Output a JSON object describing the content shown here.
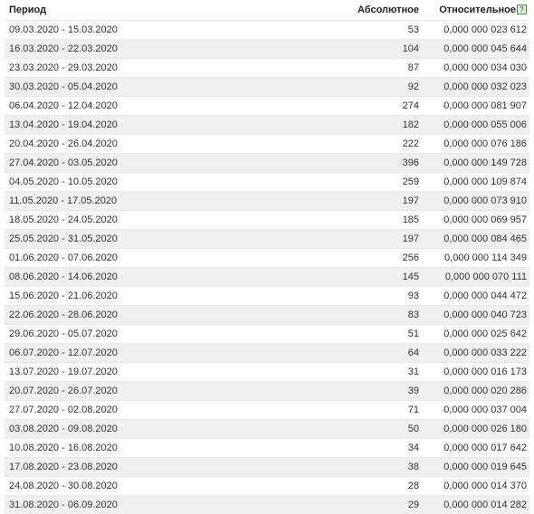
{
  "headers": {
    "period": "Период",
    "absolute": "Абсолютное",
    "relative": "Относительное",
    "help_symbol": "?"
  },
  "rows": [
    {
      "period": "09.03.2020 - 15.03.2020",
      "absolute": "53",
      "relative": "0,000 000 023 612"
    },
    {
      "period": "16.03.2020 - 22.03.2020",
      "absolute": "104",
      "relative": "0,000 000 045 644"
    },
    {
      "period": "23.03.2020 - 29.03.2020",
      "absolute": "87",
      "relative": "0,000 000 034 030"
    },
    {
      "period": "30.03.2020 - 05.04.2020",
      "absolute": "92",
      "relative": "0,000 000 032 023"
    },
    {
      "period": "06.04.2020 - 12.04.2020",
      "absolute": "274",
      "relative": "0,000 000 081 907"
    },
    {
      "period": "13.04.2020 - 19.04.2020",
      "absolute": "182",
      "relative": "0,000 000 055 006"
    },
    {
      "period": "20.04.2020 - 26.04.2020",
      "absolute": "222",
      "relative": "0,000 000 076 186"
    },
    {
      "period": "27.04.2020 - 03.05.2020",
      "absolute": "396",
      "relative": "0,000 000 149 728"
    },
    {
      "period": "04.05.2020 - 10.05.2020",
      "absolute": "259",
      "relative": "0,000 000 109 874"
    },
    {
      "period": "11.05.2020 - 17.05.2020",
      "absolute": "197",
      "relative": "0,000 000 073 910"
    },
    {
      "period": "18.05.2020 - 24.05.2020",
      "absolute": "185",
      "relative": "0,000 000 069 957"
    },
    {
      "period": "25.05.2020 - 31.05.2020",
      "absolute": "197",
      "relative": "0,000 000 084 465"
    },
    {
      "period": "01.06.2020 - 07.06.2020",
      "absolute": "256",
      "relative": "0,000 000 114 349"
    },
    {
      "period": "08.06.2020 - 14.06.2020",
      "absolute": "145",
      "relative": "0,000 000 070 111"
    },
    {
      "period": "15.06.2020 - 21.06.2020",
      "absolute": "93",
      "relative": "0,000 000 044 472"
    },
    {
      "period": "22.06.2020 - 28.06.2020",
      "absolute": "83",
      "relative": "0,000 000 040 723"
    },
    {
      "period": "29.06.2020 - 05.07.2020",
      "absolute": "51",
      "relative": "0,000 000 025 642"
    },
    {
      "period": "06.07.2020 - 12.07.2020",
      "absolute": "64",
      "relative": "0,000 000 033 222"
    },
    {
      "period": "13.07.2020 - 19.07.2020",
      "absolute": "31",
      "relative": "0,000 000 016 173"
    },
    {
      "period": "20.07.2020 - 26.07.2020",
      "absolute": "39",
      "relative": "0,000 000 020 286"
    },
    {
      "period": "27.07.2020 - 02.08.2020",
      "absolute": "71",
      "relative": "0,000 000 037 004"
    },
    {
      "period": "03.08.2020 - 09.08.2020",
      "absolute": "50",
      "relative": "0,000 000 026 180"
    },
    {
      "period": "10.08.2020 - 16.08.2020",
      "absolute": "34",
      "relative": "0,000 000 017 642"
    },
    {
      "period": "17.08.2020 - 23.08.2020",
      "absolute": "38",
      "relative": "0,000 000 019 645"
    },
    {
      "period": "24.08.2020 - 30.08.2020",
      "absolute": "28",
      "relative": "0,000 000 014 370"
    },
    {
      "period": "31.08.2020 - 06.09.2020",
      "absolute": "29",
      "relative": "0,000 000 014 282"
    }
  ]
}
